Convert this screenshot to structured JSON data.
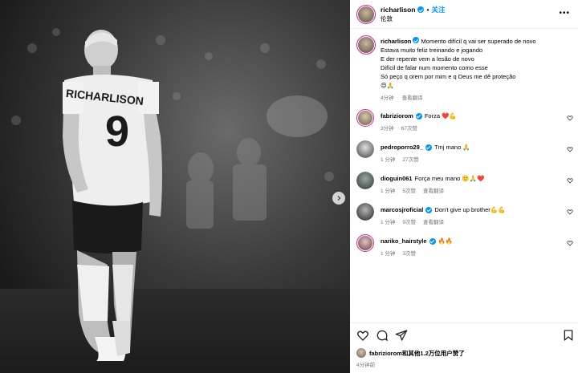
{
  "header": {
    "username": "richarlison",
    "separator": "•",
    "follow_label": "关注",
    "location": "伦敦"
  },
  "caption": {
    "username": "richarlison",
    "lines": [
      "Momento difícil q vai ser superado de novo",
      "Estava muito feliz treinando e jogando",
      "E der repente vem a lesão de novo",
      "Difícil de falar num momento como esse",
      "Só peço q orem por mim e q Deus me dê proteção",
      "😔🙏"
    ],
    "time": "4分钟",
    "translate": "查看翻译"
  },
  "comments": [
    {
      "username": "fabriziorom",
      "text": "Forza ❤️💪",
      "time": "3分钟",
      "likes": "67次赞",
      "translate": ""
    },
    {
      "username": "pedroporro29_",
      "text": "Tmj mano 🙏",
      "time": "1 分钟",
      "likes": "27次赞",
      "translate": ""
    },
    {
      "username": "dioguin061",
      "text": "Força meu mano 🙂🙏❤️",
      "time": "1 分钟",
      "likes": "5次赞",
      "translate": "查看翻译"
    },
    {
      "username": "marcosjroficial",
      "text": "Don't give up brother💪💪",
      "time": "1 分钟",
      "likes": "9次赞",
      "translate": "查看翻译"
    },
    {
      "username": "nariko_hairstyle",
      "text": "🔥🔥",
      "time": "1 分钟",
      "likes": "3次赞",
      "translate": ""
    }
  ],
  "likes_line": {
    "user": "fabriziorom",
    "rest": "和其他1.2万位用户赞了"
  },
  "post_time": "4分钟前",
  "photo": {
    "jersey_name": "RICHARLISON",
    "jersey_number": "9"
  },
  "icons": {
    "verified": "verified-badge-icon",
    "more": "more-dots-icon",
    "next": "chevron-right-icon",
    "like": "heart-icon",
    "comment": "comment-bubble-icon",
    "share": "paper-plane-icon",
    "save": "bookmark-icon"
  },
  "colors": {
    "accent": "#0095f6",
    "muted": "#737373",
    "ring": "#d6249f"
  }
}
